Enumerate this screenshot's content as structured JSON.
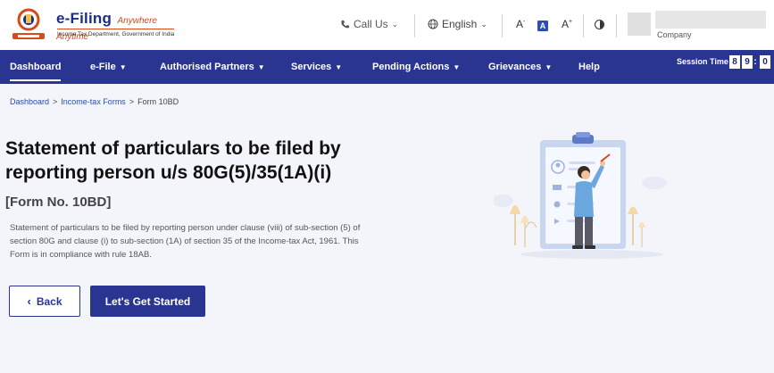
{
  "header": {
    "brand_main": "e-Filing",
    "brand_tagline": "Anywhere Anytime",
    "brand_sub": "Income Tax Department, Government of India",
    "call_label": "Call Us",
    "language_label": "English",
    "font_small": "A",
    "font_active": "A",
    "font_large": "A",
    "company_label": "Company"
  },
  "nav": {
    "items": [
      {
        "label": "Dashboard"
      },
      {
        "label": "e-File"
      },
      {
        "label": "Authorised Partners"
      },
      {
        "label": "Services"
      },
      {
        "label": "Pending Actions"
      },
      {
        "label": "Grievances"
      },
      {
        "label": "Help"
      }
    ],
    "session_label": "Session Time",
    "session_digits": [
      "8",
      "9",
      ":",
      "0"
    ]
  },
  "breadcrumb": {
    "items": [
      "Dashboard",
      "Income-tax Forms",
      "Form 10BD"
    ],
    "separator": ">"
  },
  "main": {
    "title": "Statement of particulars to be filed by reporting person u/s 80G(5)/35(1A)(i)",
    "form_no": "[Form No. 10BD]",
    "description": "Statement of particulars to be filed by reporting person under clause (viii) of sub-section (5) of section 80G and clause (i) to sub-section (1A) of section 35 of the Income-tax Act, 1961. This Form is in compliance with rule 18AB.",
    "back_label": "Back",
    "back_icon": "chevron-left-icon",
    "start_label": "Let's Get Started"
  },
  "colors": {
    "nav_bg": "#2a3591",
    "page_bg": "#f4f5fb",
    "brand_orange": "#d64a1b"
  }
}
